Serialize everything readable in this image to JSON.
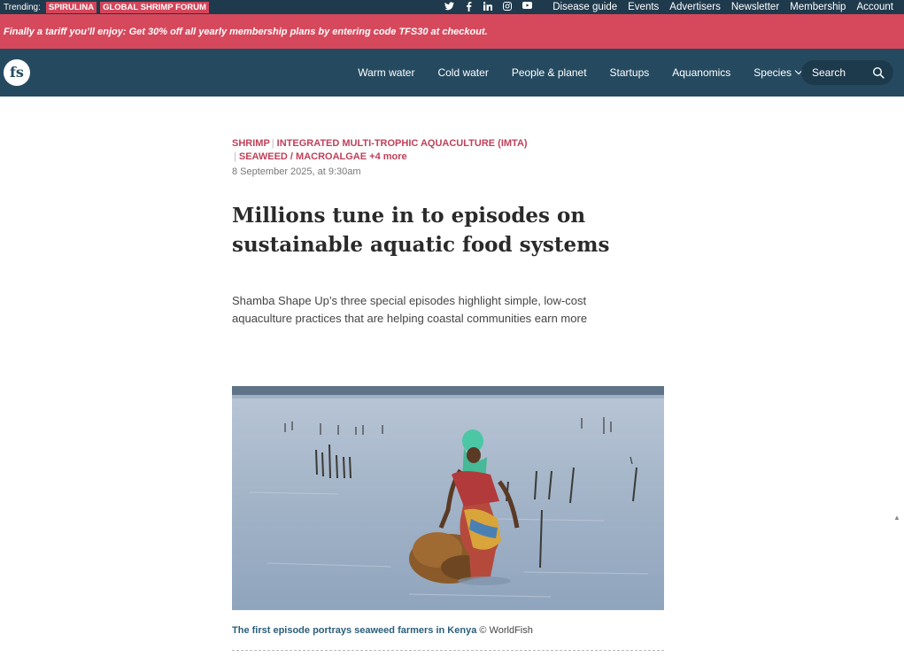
{
  "topbar": {
    "trending_label": "Trending:",
    "trending_tags": [
      "SPIRULINA",
      "GLOBAL SHRIMP FORUM"
    ],
    "social_icons": [
      "twitter-icon",
      "facebook-icon",
      "linkedin-icon",
      "instagram-icon",
      "youtube-icon"
    ],
    "links": [
      "Disease guide",
      "Events",
      "Advertisers",
      "Newsletter",
      "Membership",
      "Account"
    ]
  },
  "promo": {
    "text": "Finally a tariff you’ll enjoy: Get 30% off all yearly membership plans by entering code TFS30 at checkout."
  },
  "nav": {
    "logo_text": "fs",
    "items": [
      "Warm water",
      "Cold water",
      "People & planet",
      "Startups",
      "Aquanomics",
      "Species"
    ],
    "search_label": "Search"
  },
  "article": {
    "categories": [
      "SHRIMP",
      "INTEGRATED MULTI-TROPHIC AQUACULTURE (IMTA)",
      "SEAWEED / MACROALGAE"
    ],
    "more": "+4 more",
    "date": "8 September 2025, at 9:30am",
    "headline": "Millions tune in to episodes on sustainable aquatic food systems",
    "standfirst": "Shamba Shape Up’s three special episodes highlight simple, low-cost aquaculture practices that are helping coastal communities earn more",
    "caption_link": "The first episode portrays seaweed farmers in Kenya",
    "caption_credit": "© WorldFish"
  },
  "colors": {
    "topbar": "#1f3a4d",
    "promo": "#d6495c",
    "nav": "#254a60",
    "accent": "#c0405a"
  }
}
